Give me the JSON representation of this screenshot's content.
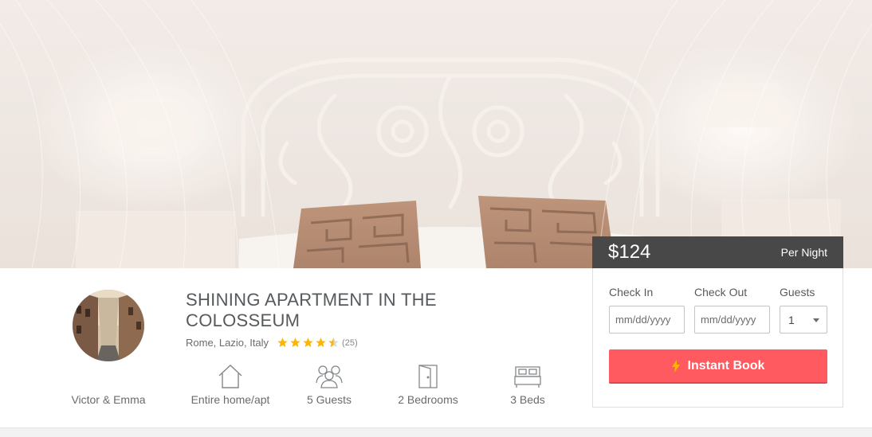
{
  "listing": {
    "title": "SHINING APARTMENT IN THE COLOSSEUM",
    "location": "Rome, Lazio, Italy",
    "rating": 4.5,
    "review_count": "(25)"
  },
  "host": {
    "name": "Victor & Emma"
  },
  "amenities": [
    {
      "icon": "house-icon",
      "label": "Entire home/apt"
    },
    {
      "icon": "guests-icon",
      "label": "5 Guests"
    },
    {
      "icon": "door-icon",
      "label": "2 Bedrooms"
    },
    {
      "icon": "bed-icon",
      "label": "3 Beds"
    }
  ],
  "booking": {
    "price": "$124",
    "per_night": "Per Night",
    "check_in_label": "Check In",
    "check_out_label": "Check Out",
    "guests_label": "Guests",
    "check_in_placeholder": "mm/dd/yyyy",
    "check_out_placeholder": "mm/dd/yyyy",
    "guests_value": "1",
    "instant_book_label": "Instant Book"
  },
  "colors": {
    "accent": "#ff5a5f",
    "price_bar": "#484848",
    "star": "#ffb400"
  }
}
